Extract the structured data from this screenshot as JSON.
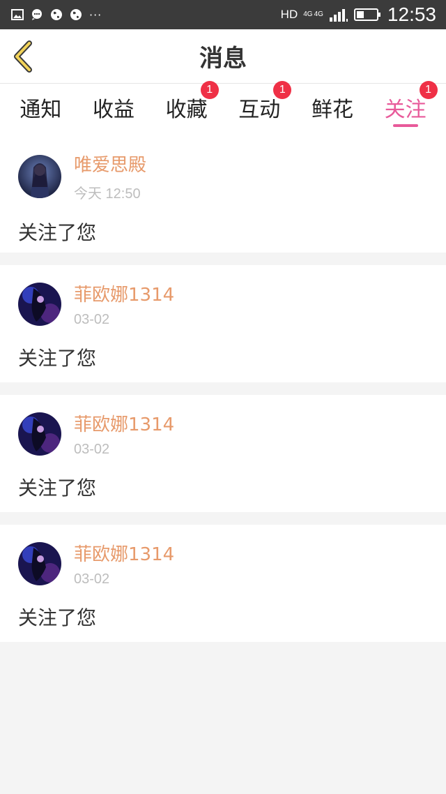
{
  "status_bar": {
    "left_icons": [
      "image-icon",
      "chat-icon",
      "globe-icon",
      "globe-icon"
    ],
    "overflow": "···",
    "hd": "HD",
    "network": [
      "4G",
      "4G"
    ],
    "time": "12:53"
  },
  "header": {
    "title": "消息",
    "back_icon": "chevron-left-icon"
  },
  "tabs": [
    {
      "label": "通知",
      "badge": "",
      "active": false
    },
    {
      "label": "收益",
      "badge": "",
      "active": false
    },
    {
      "label": "收藏",
      "badge": "1",
      "active": false
    },
    {
      "label": "互动",
      "badge": "1",
      "active": false
    },
    {
      "label": "鲜花",
      "badge": "",
      "active": false
    },
    {
      "label": "关注",
      "badge": "1",
      "active": true
    }
  ],
  "messages": [
    {
      "name": "唯爱思殿",
      "time": "今天 12:50",
      "text": "关注了您"
    },
    {
      "name": "菲欧娜1314",
      "time": "03-02",
      "text": "关注了您"
    },
    {
      "name": "菲欧娜1314",
      "time": "03-02",
      "text": "关注了您"
    },
    {
      "name": "菲欧娜1314",
      "time": "03-02",
      "text": "关注了您"
    }
  ],
  "colors": {
    "accent": "#e85a9a",
    "name": "#e79a6b",
    "badge": "#ef3046",
    "back_arrow": "#f2d35a"
  }
}
